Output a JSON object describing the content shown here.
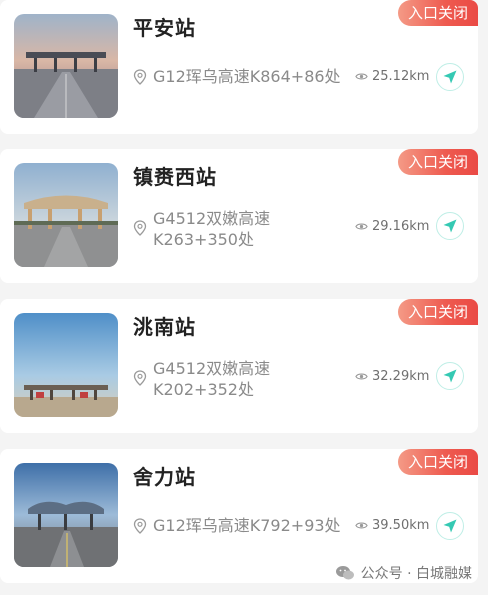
{
  "stations": [
    {
      "name": "平安站",
      "status": "入口关闭",
      "location": "G12珲乌高速K864+86处",
      "distance": "25.12km"
    },
    {
      "name": "镇赉西站",
      "status": "入口关闭",
      "location": "G4512双嫩高速K263+350处",
      "distance": "29.16km"
    },
    {
      "name": "洮南站",
      "status": "入口关闭",
      "location": "G4512双嫩高速K202+352处",
      "distance": "32.29km"
    },
    {
      "name": "舍力站",
      "status": "入口关闭",
      "location": "G12珲乌高速K792+93处",
      "distance": "39.50km"
    }
  ],
  "footer": {
    "text": "公众号 · 白城融媒"
  },
  "colors": {
    "badge": "#ee5a4f",
    "nav_accent": "#35c9b3",
    "text_muted": "#8a8a8a"
  },
  "icons": [
    "location-pin-icon",
    "eye-icon",
    "navigation-arrow-icon",
    "wechat-icon"
  ]
}
